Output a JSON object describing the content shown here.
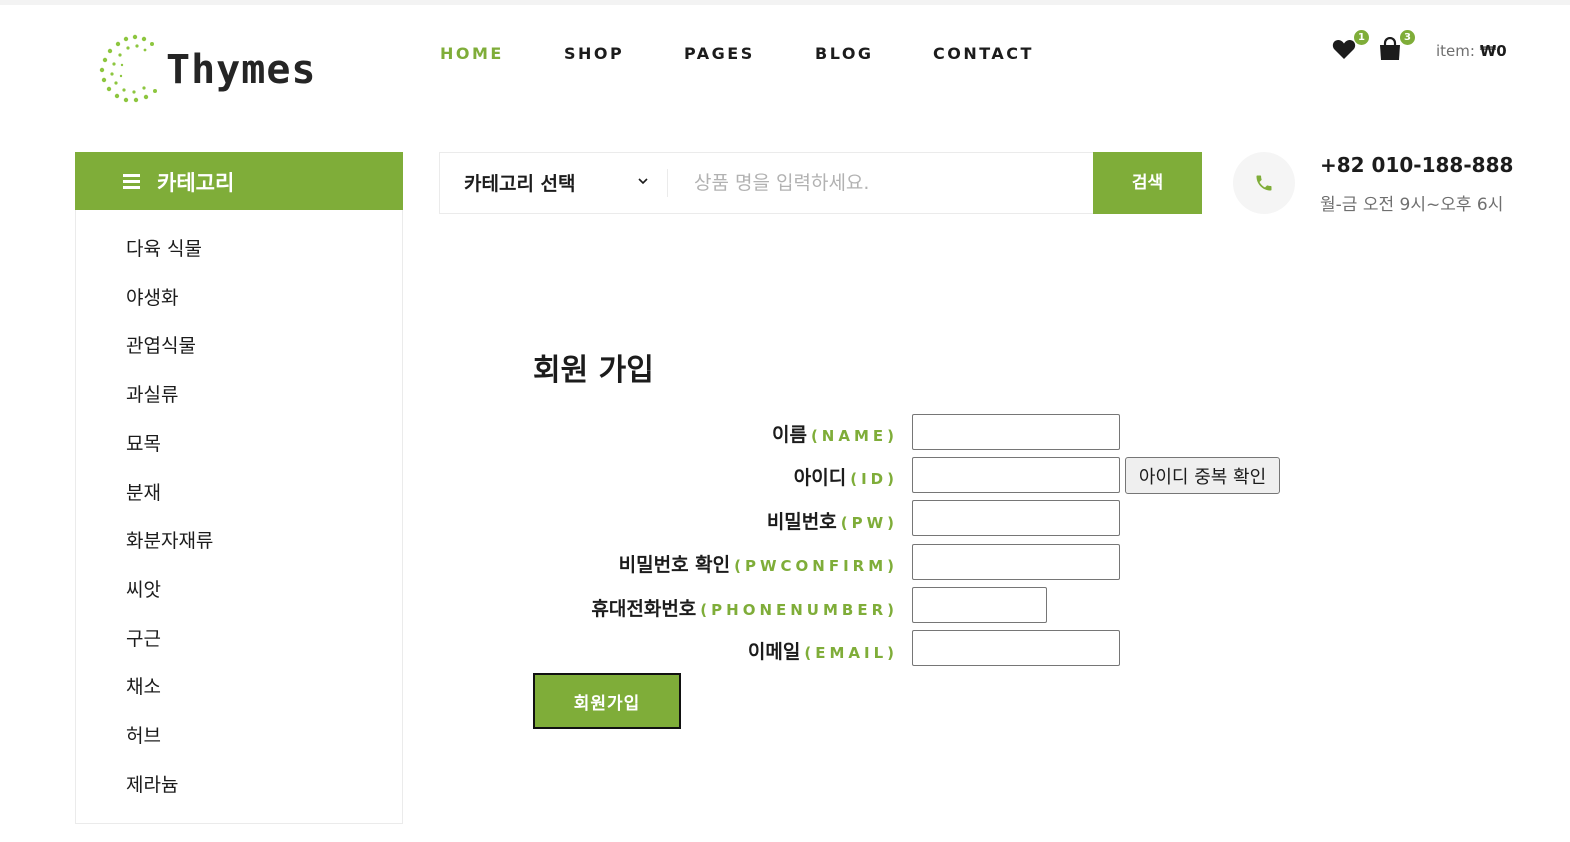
{
  "brand": {
    "name": "Thymes"
  },
  "nav": {
    "items": [
      {
        "label": "HOME",
        "active": true
      },
      {
        "label": "SHOP",
        "active": false
      },
      {
        "label": "PAGES",
        "active": false
      },
      {
        "label": "BLOG",
        "active": false
      },
      {
        "label": "CONTACT",
        "active": false
      }
    ]
  },
  "header": {
    "wishlist_count": "1",
    "cart_count": "3",
    "item_label": "item:",
    "item_total": "₩0"
  },
  "categories": {
    "title": "카테고리",
    "items": [
      "다육 식물",
      "야생화",
      "관엽식물",
      "과실류",
      "묘목",
      "분재",
      "화분자재류",
      "씨앗",
      "구근",
      "채소",
      "허브",
      "제라늄"
    ]
  },
  "search": {
    "category_select": "카테고리 선택",
    "placeholder": "상품 명을 입력하세요.",
    "button": "검색"
  },
  "contact": {
    "phone": "+82 010-188-888",
    "hours": "월-금 오전 9시~오후 6시"
  },
  "form": {
    "title": "회원 가입",
    "fields": [
      {
        "label": "이름",
        "en": "(NAME)",
        "value": ""
      },
      {
        "label": "아이디",
        "en": "(ID)",
        "value": ""
      },
      {
        "label": "비밀번호",
        "en": "(PW)",
        "value": ""
      },
      {
        "label": "비밀번호 확인",
        "en": "(PWCONFIRM)",
        "value": ""
      },
      {
        "label": "휴대전화번호",
        "en": "(PHONENUMBER)",
        "value": ""
      },
      {
        "label": "이메일",
        "en": "(EMAIL)",
        "value": ""
      }
    ],
    "dup_check_button": "아이디 중복 확인",
    "submit_button": "회원가입"
  },
  "colors": {
    "accent": "#7fad39",
    "text": "#1c1c1c",
    "muted": "#6f6f6f"
  }
}
